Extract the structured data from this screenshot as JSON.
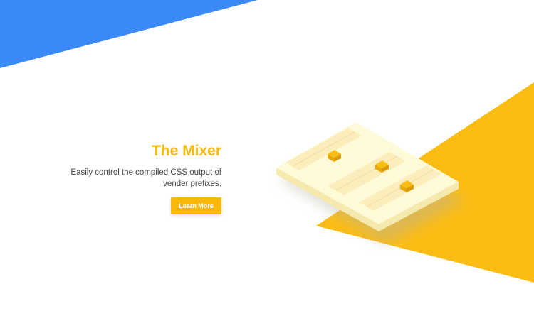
{
  "colors": {
    "blue_accent": "#3b88f7",
    "yellow_accent": "#fbbd14",
    "title_color": "#f7b90c",
    "button_color": "#f8b709",
    "panel_top": "#fffbd9",
    "panel_side": "#f5e9ad",
    "slider_track": "#fcedbd",
    "knob": "#f9be14"
  },
  "feature": {
    "title": "The Mixer",
    "description_line1": "Easily control the compiled CSS output of",
    "description_line2": "vender prefixes.",
    "button_label": "Learn More"
  },
  "icons": {
    "illustration": "mixer-console-icon"
  }
}
